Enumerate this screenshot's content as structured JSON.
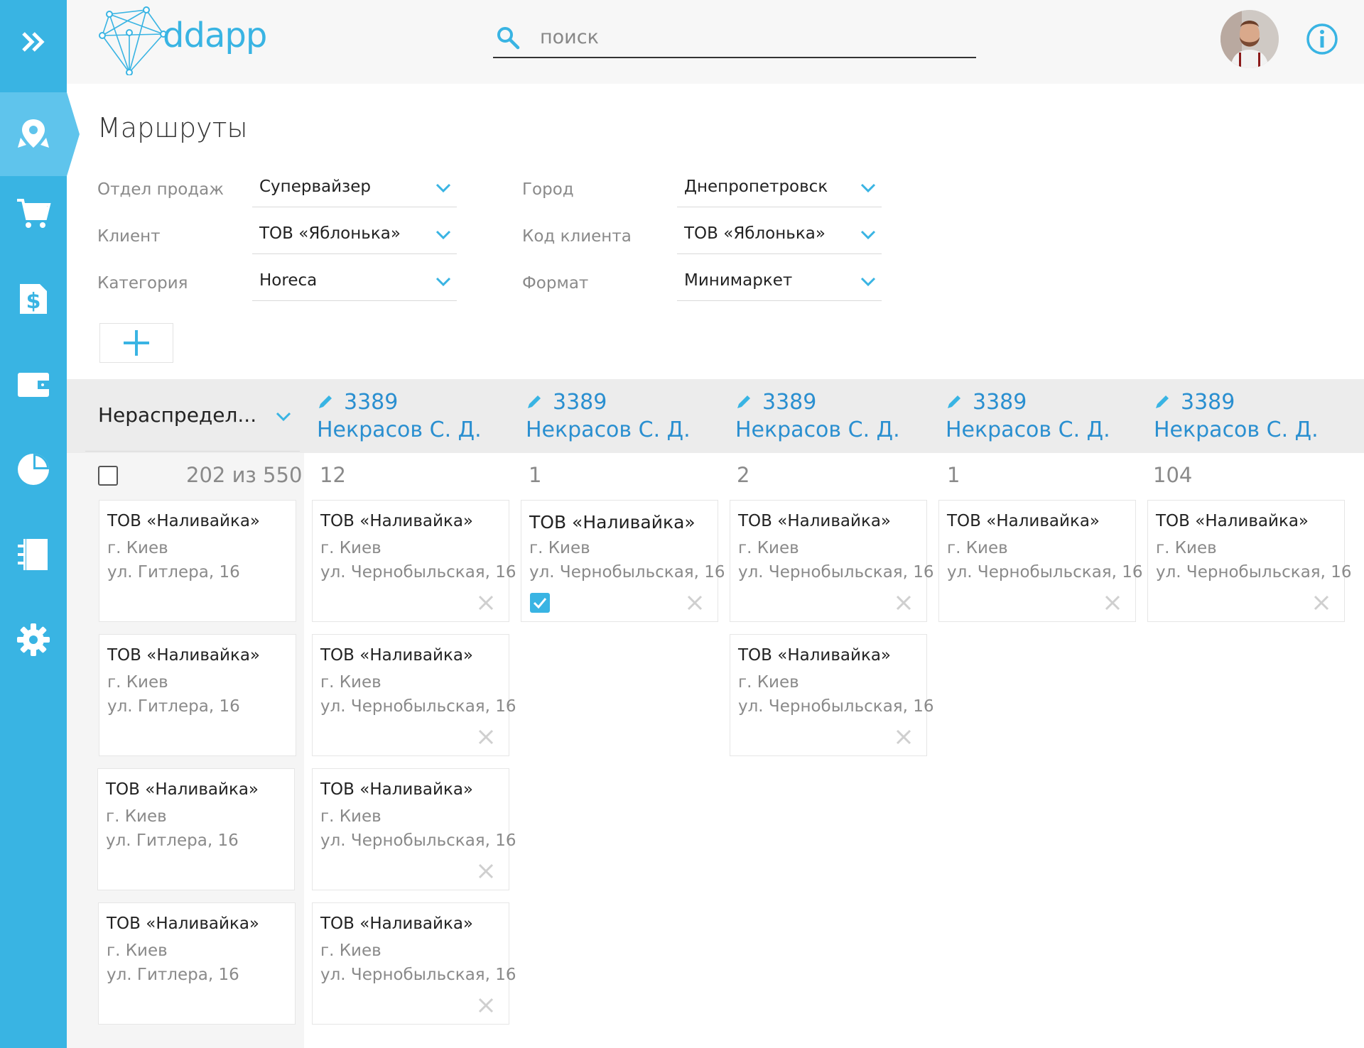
{
  "app": {
    "logo_text": "ddapp"
  },
  "search": {
    "placeholder": "поиск",
    "value": ""
  },
  "page": {
    "title": "Маршруты"
  },
  "filters": [
    {
      "label": "Отдел продаж",
      "value": "Супервайзер"
    },
    {
      "label": "Клиент",
      "value": "ТОВ «Яблонька»"
    },
    {
      "label": "Категория",
      "value": "Horeca"
    },
    {
      "label": "Город",
      "value": "Днепропетровск"
    },
    {
      "label": "Код клиента",
      "value": "ТОВ «Яблонька»"
    },
    {
      "label": "Формат",
      "value": "Минимаркет"
    }
  ],
  "board": {
    "unassigned": {
      "selected": "Нераспредел...",
      "count": "202 из 550"
    },
    "columns": [
      {
        "code": "3389",
        "name": "Некрасов С. Д.",
        "count": "12"
      },
      {
        "code": "3389",
        "name": "Некрасов С. Д.",
        "count": "1"
      },
      {
        "code": "3389",
        "name": "Некрасов С. Д.",
        "count": "2"
      },
      {
        "code": "3389",
        "name": "Некрасов С. Д.",
        "count": "1"
      },
      {
        "code": "3389",
        "name": "Некрасов С. Д.",
        "count": "104"
      }
    ],
    "card_unassigned": {
      "name": "ТОВ «Наливайка»",
      "city": "г. Киев",
      "address": "ул. Гитлера, 16"
    },
    "card_assigned": {
      "name": "ТОВ «Наливайка»",
      "city": "г. Киев",
      "address": "ул. Чернобыльская, 16"
    }
  },
  "colors": {
    "accent": "#39b4e3",
    "link": "#2a8fd0",
    "sidebar_active": "#5fc4ec"
  },
  "icons": [
    "expand-icon",
    "map-pin-icon",
    "cart-icon",
    "invoice-dollar-icon",
    "wallet-icon",
    "pie-chart-icon",
    "catalog-icon",
    "gear-icon",
    "search-icon",
    "info-icon",
    "chevron-down-icon",
    "pencil-icon",
    "close-icon",
    "plus-icon"
  ]
}
